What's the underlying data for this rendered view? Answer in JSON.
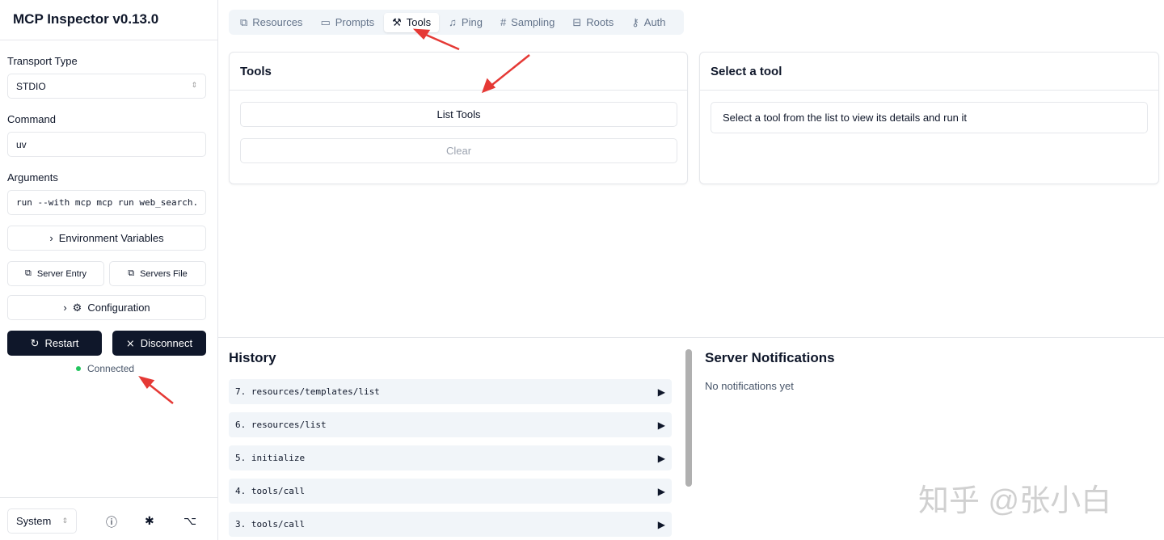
{
  "app": {
    "title": "MCP Inspector v0.13.0"
  },
  "sidebar": {
    "transport_label": "Transport Type",
    "transport_value": "STDIO",
    "command_label": "Command",
    "command_value": "uv",
    "arguments_label": "Arguments",
    "arguments_value": "run --with mcp mcp run web_search.",
    "env_vars": "Environment Variables",
    "server_entry": "Server Entry",
    "servers_file": "Servers File",
    "configuration": "Configuration",
    "restart": "Restart",
    "disconnect": "Disconnect",
    "status": "Connected",
    "status_color": "#22c55e",
    "theme": "System"
  },
  "tabs": [
    {
      "label": "Resources",
      "icon": "copy"
    },
    {
      "label": "Prompts",
      "icon": "message"
    },
    {
      "label": "Tools",
      "icon": "hammer",
      "active": true
    },
    {
      "label": "Ping",
      "icon": "bell"
    },
    {
      "label": "Sampling",
      "icon": "hash"
    },
    {
      "label": "Roots",
      "icon": "folder-tree"
    },
    {
      "label": "Auth",
      "icon": "key"
    }
  ],
  "tools": {
    "title": "Tools",
    "list_button": "List Tools",
    "clear_button": "Clear"
  },
  "detail": {
    "title": "Select a tool",
    "message": "Select a tool from the list to view its details and run it"
  },
  "history": {
    "title": "History",
    "items": [
      "7. resources/templates/list",
      "6. resources/list",
      "5. initialize",
      "4. tools/call",
      "3. tools/call"
    ]
  },
  "notifications": {
    "title": "Server Notifications",
    "empty": "No notifications yet"
  },
  "watermark": "知乎 @张小白",
  "annotation_color": "#e53935"
}
